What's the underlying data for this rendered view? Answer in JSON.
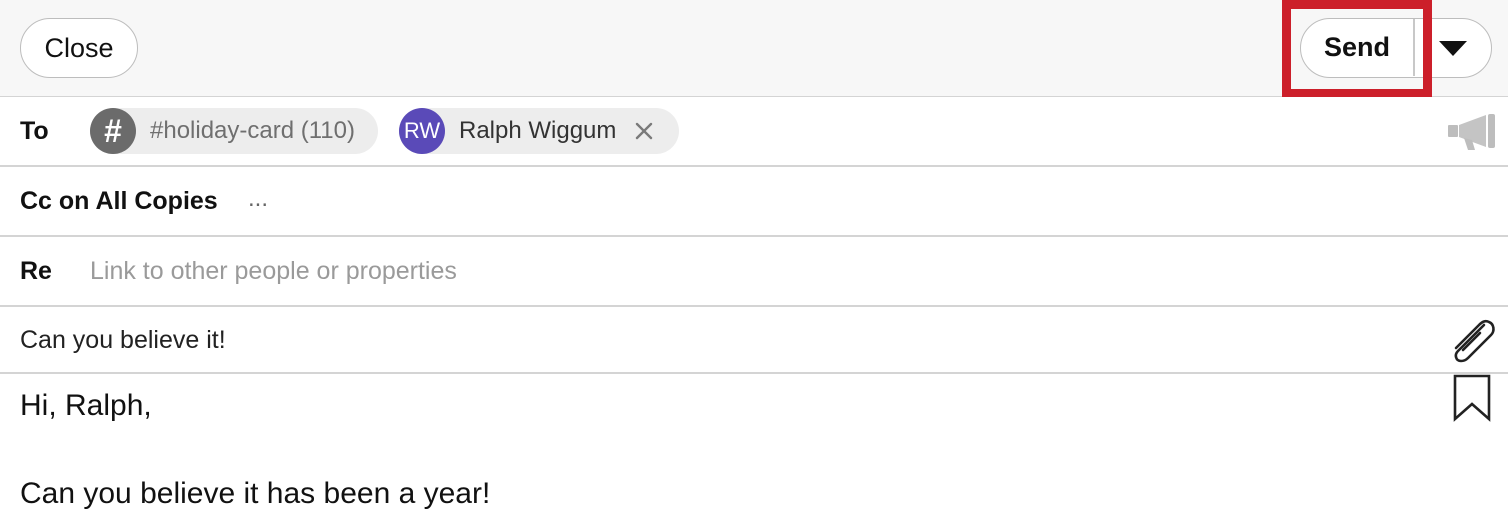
{
  "toolbar": {
    "close_label": "Close",
    "send_label": "Send",
    "dropdown_icon": "caret-down-icon"
  },
  "to": {
    "label": "To",
    "recipients": [
      {
        "avatar": "#",
        "name": "#holiday-card (110)"
      },
      {
        "avatar": "RW",
        "name": "Ralph Wiggum",
        "avatar_color": "#5a4ab8",
        "removable": true
      }
    ],
    "megaphone_icon": "megaphone-icon"
  },
  "cc": {
    "label": "Cc on All Copies",
    "more": "..."
  },
  "re": {
    "label": "Re",
    "placeholder": "Link to other people or properties",
    "value": ""
  },
  "subject": {
    "value": "Can you believe it!",
    "attachment_icon": "paperclip-icon"
  },
  "body": {
    "lines": [
      "Hi, Ralph,",
      "",
      "Can you believe it has been a year!"
    ],
    "bookmark_icon": "bookmark-icon"
  },
  "colors": {
    "highlight": "#cc1f2a",
    "toolbar_bg": "#f7f7f7",
    "avatar_rw": "#5a4ab8",
    "avatar_hash": "#6b6b6b"
  }
}
